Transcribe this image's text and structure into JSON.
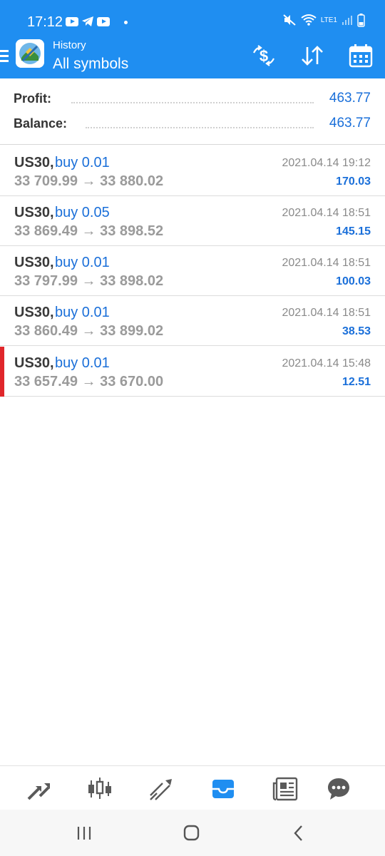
{
  "status_bar": {
    "time": "17:12",
    "network": "LTE1"
  },
  "header": {
    "subtitle": "History",
    "title": "All symbols",
    "icons": [
      "menu-icon",
      "metatrader-logo",
      "currency-exchange-icon",
      "sort-icon",
      "calendar-icon"
    ]
  },
  "summary": {
    "profit_label": "Profit:",
    "profit_value": "463.77",
    "balance_label": "Balance:",
    "balance_value": "463.77"
  },
  "trades": [
    {
      "symbol": "US30,",
      "side": "buy 0.01",
      "open": "33 709.99",
      "close": "33 880.02",
      "arrow": "→",
      "time": "2021.04.14 19:12",
      "profit": "170.03"
    },
    {
      "symbol": "US30,",
      "side": "buy 0.05",
      "open": "33 869.49",
      "close": "33 898.52",
      "arrow": "→",
      "time": "2021.04.14 18:51",
      "profit": "145.15"
    },
    {
      "symbol": "US30,",
      "side": "buy 0.01",
      "open": "33 797.99",
      "close": "33 898.02",
      "arrow": "→",
      "time": "2021.04.14 18:51",
      "profit": "100.03"
    },
    {
      "symbol": "US30,",
      "side": "buy 0.01",
      "open": "33 860.49",
      "close": "33 899.02",
      "arrow": "→",
      "time": "2021.04.14 18:51",
      "profit": "38.53"
    },
    {
      "symbol": "US30,",
      "side": "buy 0.01",
      "open": "33 657.49",
      "close": "33 670.00",
      "arrow": "→",
      "time": "2021.04.14 15:48",
      "profit": "12.51",
      "selected": true
    }
  ],
  "bottom_tabs": [
    {
      "name": "quotes-tab",
      "icon": "quotes-icon"
    },
    {
      "name": "chart-tab",
      "icon": "candlestick-icon"
    },
    {
      "name": "trade-tab",
      "icon": "trend-icon"
    },
    {
      "name": "history-tab",
      "icon": "inbox-icon",
      "active": true
    },
    {
      "name": "news-tab",
      "icon": "newspaper-icon"
    },
    {
      "name": "chat-tab",
      "icon": "chat-icon"
    }
  ],
  "colors": {
    "accent": "#1f8ef1",
    "value_blue": "#1a6fd9",
    "selected_marker": "#e0262b",
    "inactive_icon": "#5a5a5a"
  }
}
